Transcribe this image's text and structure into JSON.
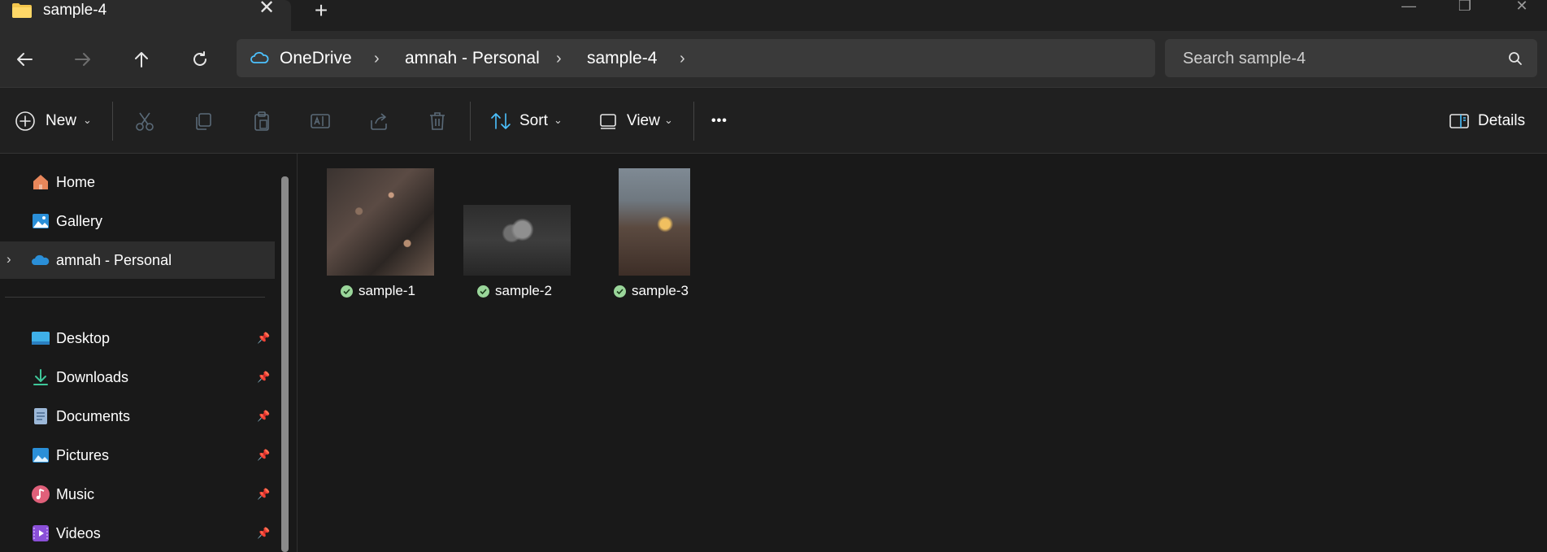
{
  "window": {
    "tab_title": "sample-4",
    "new_tab_symbol": "+",
    "close_symbol": "✕",
    "controls": {
      "minimize": "—",
      "restore": "❐",
      "close": "✕"
    }
  },
  "nav": {
    "back_icon": "arrow-left-icon",
    "forward_icon": "arrow-right-icon",
    "up_icon": "arrow-up-icon",
    "refresh_icon": "refresh-icon"
  },
  "breadcrumb": {
    "items": [
      "OneDrive",
      "amnah - Personal",
      "sample-4"
    ],
    "separator": "›"
  },
  "search": {
    "placeholder": "Search sample-4"
  },
  "toolbar": {
    "new_label": "New",
    "sort_label": "Sort",
    "view_label": "View",
    "more_label": "•••",
    "details_label": "Details"
  },
  "sidebar": {
    "items": [
      {
        "label": "Home",
        "icon": "home-icon"
      },
      {
        "label": "Gallery",
        "icon": "gallery-icon"
      },
      {
        "label": "amnah - Personal",
        "icon": "onedrive-cloud-icon",
        "selected": true
      }
    ],
    "quick_access": [
      {
        "label": "Desktop",
        "icon": "desktop-icon",
        "pinned": true
      },
      {
        "label": "Downloads",
        "icon": "download-icon",
        "pinned": true
      },
      {
        "label": "Documents",
        "icon": "document-icon",
        "pinned": true
      },
      {
        "label": "Pictures",
        "icon": "pictures-icon",
        "pinned": true
      },
      {
        "label": "Music",
        "icon": "music-icon",
        "pinned": true
      },
      {
        "label": "Videos",
        "icon": "videos-icon",
        "pinned": true
      }
    ]
  },
  "files": [
    {
      "name": "sample-1",
      "status": "synced"
    },
    {
      "name": "sample-2",
      "status": "synced"
    },
    {
      "name": "sample-3",
      "status": "synced"
    }
  ],
  "colors": {
    "background": "#191919",
    "toolbar": "#202020",
    "navbar": "#2b2b2b",
    "accent": "#4cc2ff",
    "sync_check": "#9ad69a"
  }
}
